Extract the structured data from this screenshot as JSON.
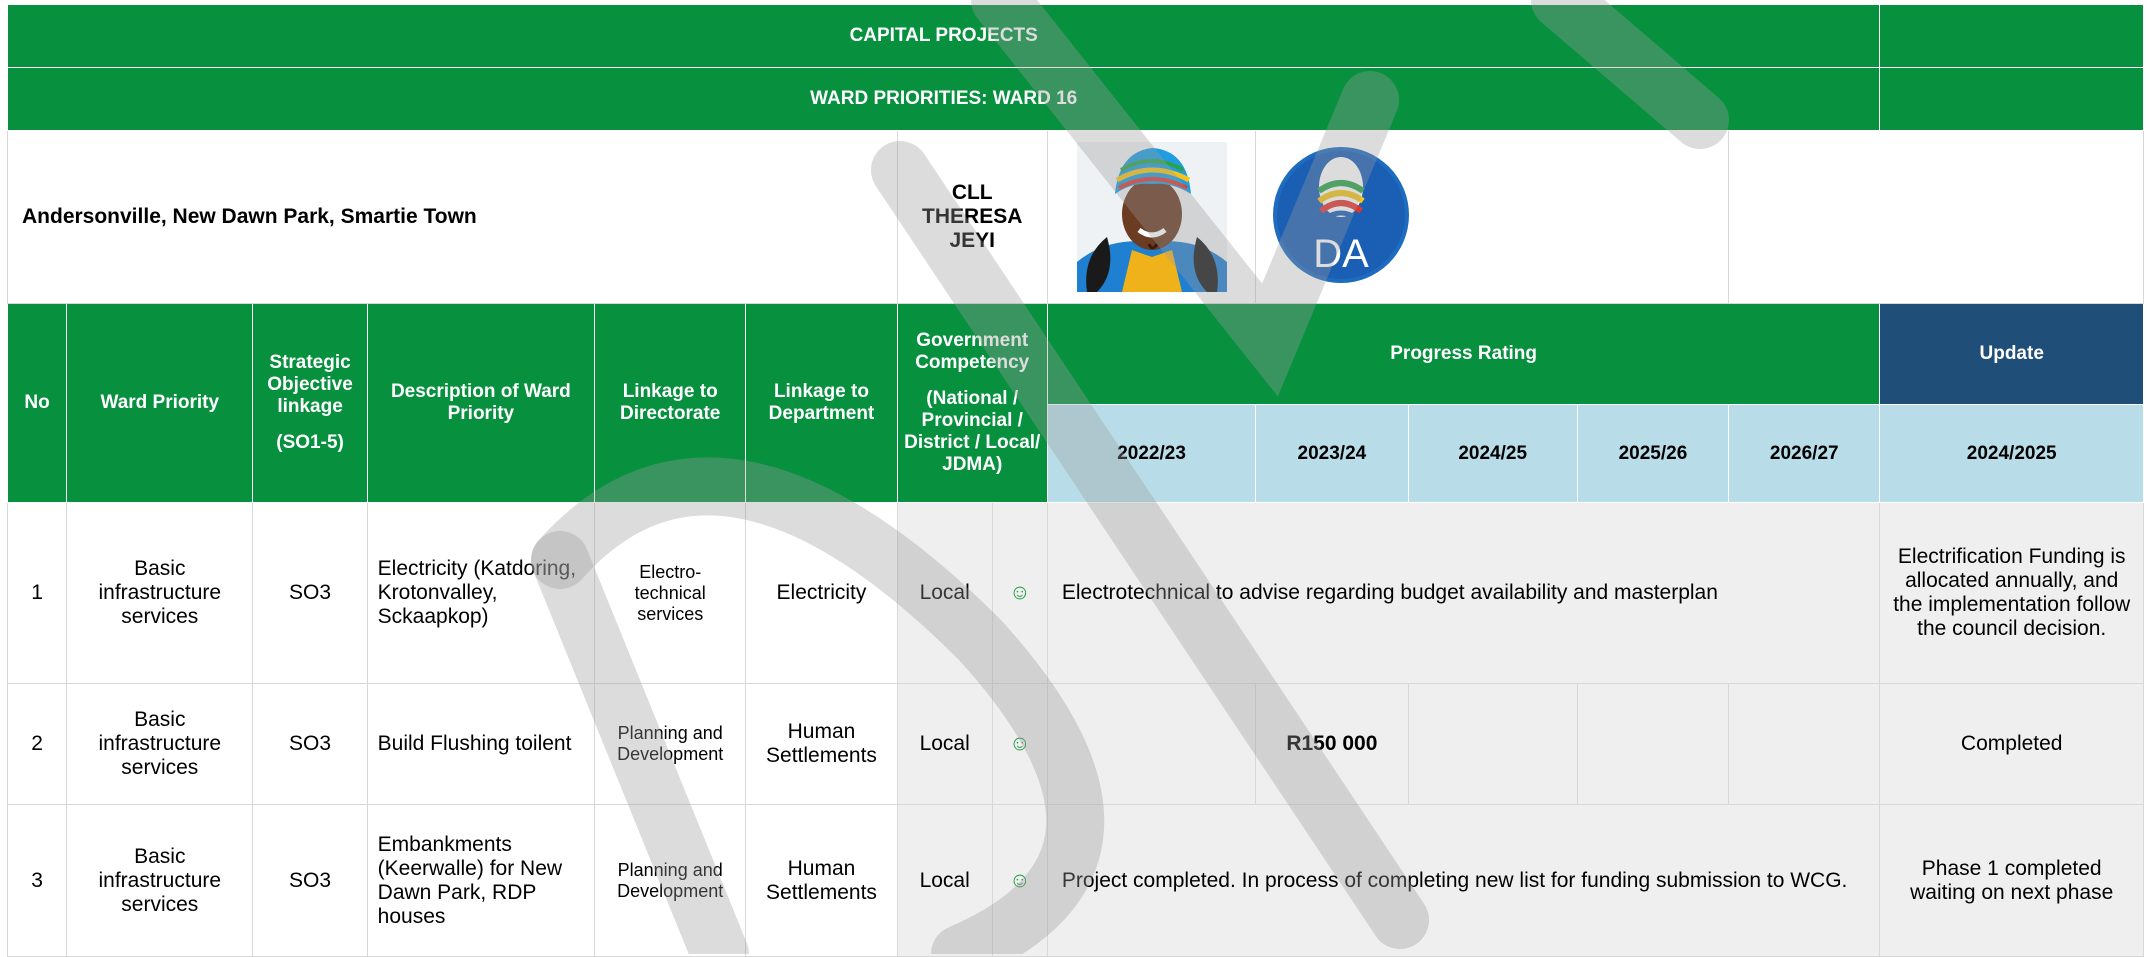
{
  "title": "CAPITAL PROJECTS",
  "subtitle": "WARD PRIORITIES: WARD 16",
  "ward_areas": "Andersonville, New Dawn Park, Smartie Town",
  "councillor": "CLL THERESA JEYI",
  "party_logo_text": "DA",
  "headers": {
    "no": "No",
    "ward_priority": "Ward Priority",
    "strategic_objective": "Strategic Objective linkage",
    "strategic_objective_range": "(SO1-5)",
    "description": "Description of Ward Priority",
    "directorate": "Linkage to Directorate",
    "department": "Linkage to Department",
    "competency": "Government Competency",
    "competency_options": "(National / Provincial / District / Local/ JDMA)",
    "progress_rating": "Progress Rating",
    "update": "Update",
    "years": [
      "2022/23",
      "2023/24",
      "2024/25",
      "2025/26",
      "2026/27"
    ],
    "update_year": "2024/2025"
  },
  "rows": [
    {
      "no": "1",
      "priority": "Basic infrastructure services",
      "so": "SO3",
      "description": "Electricity (Katdoring, Krotonvalley, Sckaapkop)",
      "directorate": "Electro-technical services",
      "department": "Electricity",
      "competency": "Local",
      "rating_icon": "☺",
      "progress_text": "Electrotechnical to advise regarding budget availability and masterplan",
      "update": "Electrification Funding is allocated annually, and the implementation follow the council decision."
    },
    {
      "no": "2",
      "priority": "Basic infrastructure services",
      "so": "SO3",
      "description": "Build Flushing toilent",
      "directorate": "Planning and Development",
      "department": "Human Settlements",
      "competency": "Local",
      "rating_icon": "☺",
      "year_values": [
        "",
        "R150 000",
        "",
        "",
        ""
      ],
      "update": "Completed"
    },
    {
      "no": "3",
      "priority": "Basic infrastructure services",
      "so": "SO3",
      "description": "Embankments (Keerwalle) for New Dawn Park, RDP houses",
      "directorate": "Planning and Development",
      "department": "Human Settlements",
      "competency": "Local",
      "rating_icon": "☺",
      "progress_text": "Project completed. In process of completing new list for funding submission to WCG.",
      "update": "Phase 1 completed waiting on next phase"
    }
  ],
  "colors": {
    "header_green": "#07913f",
    "update_navy": "#1f4e79",
    "year_blue": "#b8dde8",
    "smiley_green": "#1e9b3f",
    "row_grey": "#efefef"
  }
}
